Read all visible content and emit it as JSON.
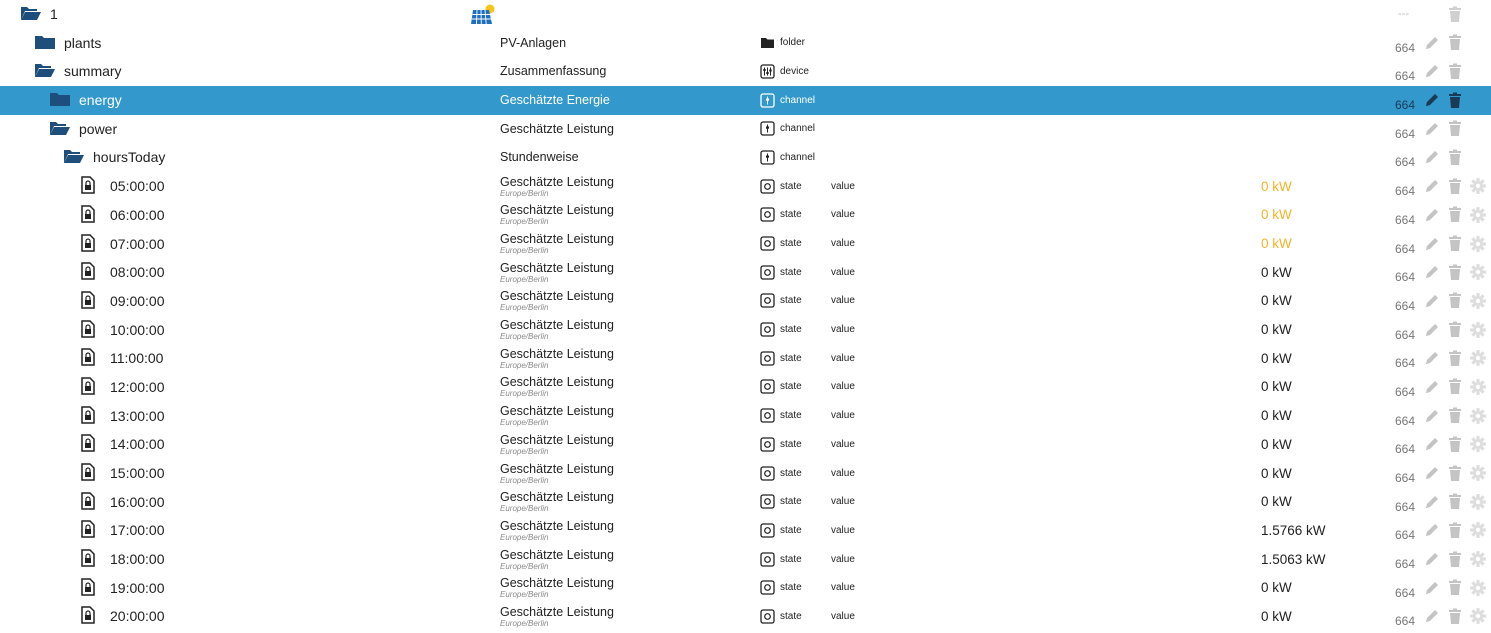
{
  "colors": {
    "selected_bg": "#3399cc",
    "folder_icon": "#1e4f7c",
    "value_warn": "#f0b428",
    "action_icon": "#c4c4c4"
  },
  "rows": [
    {
      "name": "1",
      "level": 0,
      "icon": "folder-open-icon",
      "adapter_logo": "solar-panel-logo",
      "desc": "",
      "tz": "",
      "type": "",
      "type_icon": "",
      "role": "",
      "value": "",
      "value_warn": false,
      "acl": "---",
      "actions": [
        "delete"
      ],
      "selected": false
    },
    {
      "name": "plants",
      "level": 1,
      "icon": "folder-closed-icon",
      "desc": "PV-Anlagen",
      "tz": "",
      "type": "folder",
      "type_icon": "folder-type-icon",
      "role": "",
      "value": "",
      "value_warn": false,
      "acl": "664",
      "actions": [
        "edit",
        "delete"
      ],
      "selected": false
    },
    {
      "name": "summary",
      "level": 1,
      "icon": "folder-open-icon",
      "desc": "Zusammenfassung",
      "tz": "",
      "type": "device",
      "type_icon": "device-type-icon",
      "role": "",
      "value": "",
      "value_warn": false,
      "acl": "664",
      "actions": [
        "edit",
        "delete"
      ],
      "selected": false
    },
    {
      "name": "energy",
      "level": 2,
      "icon": "folder-closed-icon",
      "desc": "Geschätzte Energie",
      "tz": "",
      "type": "channel",
      "type_icon": "channel-type-icon",
      "role": "",
      "value": "",
      "value_warn": false,
      "acl": "664",
      "actions": [
        "edit",
        "delete"
      ],
      "selected": true
    },
    {
      "name": "power",
      "level": 2,
      "icon": "folder-open-icon",
      "desc": "Geschätzte Leistung",
      "tz": "",
      "type": "channel",
      "type_icon": "channel-type-icon",
      "role": "",
      "value": "",
      "value_warn": false,
      "acl": "664",
      "actions": [
        "edit",
        "delete"
      ],
      "selected": false
    },
    {
      "name": "hoursToday",
      "level": 3,
      "icon": "folder-open-icon",
      "desc": "Stundenweise",
      "tz": "",
      "type": "channel",
      "type_icon": "channel-type-icon",
      "role": "",
      "value": "",
      "value_warn": false,
      "acl": "664",
      "actions": [
        "edit",
        "delete"
      ],
      "selected": false
    },
    {
      "name": "05:00:00",
      "level": 4,
      "icon": "file-lock-icon",
      "desc": "Geschätzte Leistung",
      "tz": "Europe/Berlin",
      "type": "state",
      "type_icon": "state-type-icon",
      "role": "value",
      "value": "0 kW",
      "value_warn": true,
      "acl": "664",
      "actions": [
        "edit",
        "delete",
        "settings"
      ],
      "selected": false
    },
    {
      "name": "06:00:00",
      "level": 4,
      "icon": "file-lock-icon",
      "desc": "Geschätzte Leistung",
      "tz": "Europe/Berlin",
      "type": "state",
      "type_icon": "state-type-icon",
      "role": "value",
      "value": "0 kW",
      "value_warn": true,
      "acl": "664",
      "actions": [
        "edit",
        "delete",
        "settings"
      ],
      "selected": false
    },
    {
      "name": "07:00:00",
      "level": 4,
      "icon": "file-lock-icon",
      "desc": "Geschätzte Leistung",
      "tz": "Europe/Berlin",
      "type": "state",
      "type_icon": "state-type-icon",
      "role": "value",
      "value": "0 kW",
      "value_warn": true,
      "acl": "664",
      "actions": [
        "edit",
        "delete",
        "settings"
      ],
      "selected": false
    },
    {
      "name": "08:00:00",
      "level": 4,
      "icon": "file-lock-icon",
      "desc": "Geschätzte Leistung",
      "tz": "Europe/Berlin",
      "type": "state",
      "type_icon": "state-type-icon",
      "role": "value",
      "value": "0 kW",
      "value_warn": false,
      "acl": "664",
      "actions": [
        "edit",
        "delete",
        "settings"
      ],
      "selected": false
    },
    {
      "name": "09:00:00",
      "level": 4,
      "icon": "file-lock-icon",
      "desc": "Geschätzte Leistung",
      "tz": "Europe/Berlin",
      "type": "state",
      "type_icon": "state-type-icon",
      "role": "value",
      "value": "0 kW",
      "value_warn": false,
      "acl": "664",
      "actions": [
        "edit",
        "delete",
        "settings"
      ],
      "selected": false
    },
    {
      "name": "10:00:00",
      "level": 4,
      "icon": "file-lock-icon",
      "desc": "Geschätzte Leistung",
      "tz": "Europe/Berlin",
      "type": "state",
      "type_icon": "state-type-icon",
      "role": "value",
      "value": "0 kW",
      "value_warn": false,
      "acl": "664",
      "actions": [
        "edit",
        "delete",
        "settings"
      ],
      "selected": false
    },
    {
      "name": "11:00:00",
      "level": 4,
      "icon": "file-lock-icon",
      "desc": "Geschätzte Leistung",
      "tz": "Europe/Berlin",
      "type": "state",
      "type_icon": "state-type-icon",
      "role": "value",
      "value": "0 kW",
      "value_warn": false,
      "acl": "664",
      "actions": [
        "edit",
        "delete",
        "settings"
      ],
      "selected": false
    },
    {
      "name": "12:00:00",
      "level": 4,
      "icon": "file-lock-icon",
      "desc": "Geschätzte Leistung",
      "tz": "Europe/Berlin",
      "type": "state",
      "type_icon": "state-type-icon",
      "role": "value",
      "value": "0 kW",
      "value_warn": false,
      "acl": "664",
      "actions": [
        "edit",
        "delete",
        "settings"
      ],
      "selected": false
    },
    {
      "name": "13:00:00",
      "level": 4,
      "icon": "file-lock-icon",
      "desc": "Geschätzte Leistung",
      "tz": "Europe/Berlin",
      "type": "state",
      "type_icon": "state-type-icon",
      "role": "value",
      "value": "0 kW",
      "value_warn": false,
      "acl": "664",
      "actions": [
        "edit",
        "delete",
        "settings"
      ],
      "selected": false
    },
    {
      "name": "14:00:00",
      "level": 4,
      "icon": "file-lock-icon",
      "desc": "Geschätzte Leistung",
      "tz": "Europe/Berlin",
      "type": "state",
      "type_icon": "state-type-icon",
      "role": "value",
      "value": "0 kW",
      "value_warn": false,
      "acl": "664",
      "actions": [
        "edit",
        "delete",
        "settings"
      ],
      "selected": false
    },
    {
      "name": "15:00:00",
      "level": 4,
      "icon": "file-lock-icon",
      "desc": "Geschätzte Leistung",
      "tz": "Europe/Berlin",
      "type": "state",
      "type_icon": "state-type-icon",
      "role": "value",
      "value": "0 kW",
      "value_warn": false,
      "acl": "664",
      "actions": [
        "edit",
        "delete",
        "settings"
      ],
      "selected": false
    },
    {
      "name": "16:00:00",
      "level": 4,
      "icon": "file-lock-icon",
      "desc": "Geschätzte Leistung",
      "tz": "Europe/Berlin",
      "type": "state",
      "type_icon": "state-type-icon",
      "role": "value",
      "value": "0 kW",
      "value_warn": false,
      "acl": "664",
      "actions": [
        "edit",
        "delete",
        "settings"
      ],
      "selected": false
    },
    {
      "name": "17:00:00",
      "level": 4,
      "icon": "file-lock-icon",
      "desc": "Geschätzte Leistung",
      "tz": "Europe/Berlin",
      "type": "state",
      "type_icon": "state-type-icon",
      "role": "value",
      "value": "1.5766 kW",
      "value_warn": false,
      "acl": "664",
      "actions": [
        "edit",
        "delete",
        "settings"
      ],
      "selected": false
    },
    {
      "name": "18:00:00",
      "level": 4,
      "icon": "file-lock-icon",
      "desc": "Geschätzte Leistung",
      "tz": "Europe/Berlin",
      "type": "state",
      "type_icon": "state-type-icon",
      "role": "value",
      "value": "1.5063 kW",
      "value_warn": false,
      "acl": "664",
      "actions": [
        "edit",
        "delete",
        "settings"
      ],
      "selected": false
    },
    {
      "name": "19:00:00",
      "level": 4,
      "icon": "file-lock-icon",
      "desc": "Geschätzte Leistung",
      "tz": "Europe/Berlin",
      "type": "state",
      "type_icon": "state-type-icon",
      "role": "value",
      "value": "0 kW",
      "value_warn": false,
      "acl": "664",
      "actions": [
        "edit",
        "delete",
        "settings"
      ],
      "selected": false
    },
    {
      "name": "20:00:00",
      "level": 4,
      "icon": "file-lock-icon",
      "desc": "Geschätzte Leistung",
      "tz": "Europe/Berlin",
      "type": "state",
      "type_icon": "state-type-icon",
      "role": "value",
      "value": "0 kW",
      "value_warn": false,
      "acl": "664",
      "actions": [
        "edit",
        "delete",
        "settings"
      ],
      "selected": false
    }
  ]
}
